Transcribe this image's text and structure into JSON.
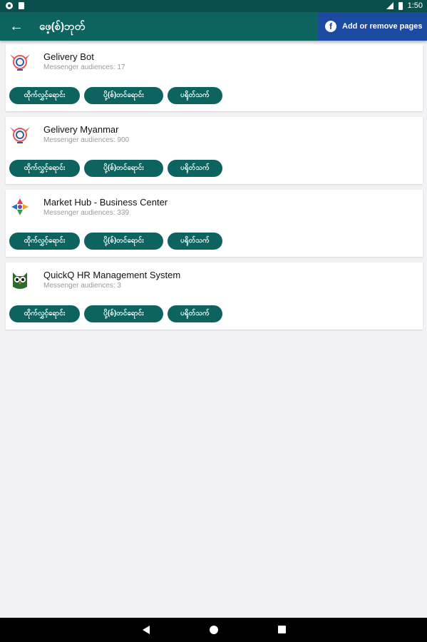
{
  "status_bar": {
    "time": "1:50"
  },
  "app_bar": {
    "title": "ဖေ့(စ်)ဘုတ်",
    "add_pages_label": "Add or remove pages"
  },
  "buttons": {
    "b1": "ထိုက်လွှင့်ရောင်း",
    "b2": "ပို့(စ်)တင်ရောင်း",
    "b3": "ပရိုတ်သက်"
  },
  "pages": [
    {
      "name": "Gelivery Bot",
      "audience": "Messenger audiences: 17",
      "icon": "gelivery-logo-icon"
    },
    {
      "name": "Gelivery Myanmar",
      "audience": "Messenger audiences: 900",
      "icon": "gelivery-logo-icon"
    },
    {
      "name": "Market Hub - Business Center",
      "audience": "Messenger audiences: 339",
      "icon": "market-hub-logo-icon"
    },
    {
      "name": "QuickQ HR Management System",
      "audience": "Messenger audiences: 3",
      "icon": "quickq-owl-logo-icon"
    }
  ],
  "colors": {
    "primary": "#0d6360",
    "status_bar": "#0a4f4c",
    "fb_button": "#1c4aa0",
    "background": "#f2f2f4"
  }
}
